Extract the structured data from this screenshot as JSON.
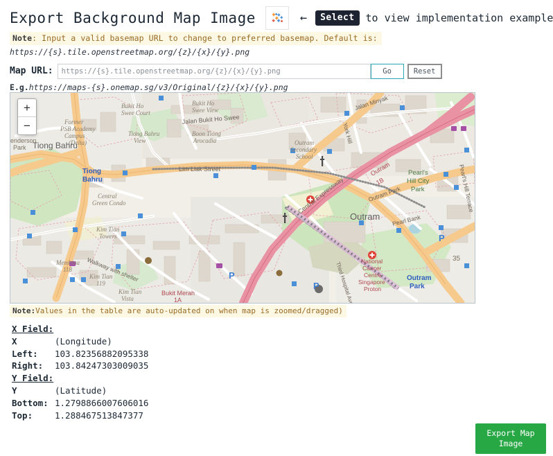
{
  "header": {
    "title": "Export Background Map Image",
    "icon": "scatter-sparkle-icon",
    "arrow": "←",
    "select_badge": "Select",
    "tail_text": "to view implementation example."
  },
  "note_top": {
    "label": "Note",
    "text": ": Input a valid basemap URL to change to preferred basemap. Default is:",
    "default_url": "https://{s}.tile.openstreetmap.org/{z}/{x}/{y}.png",
    "background": "#fcf8e3",
    "text_color": "#9a6b25"
  },
  "url_row": {
    "label": "Map URL:",
    "input_value": "https://{s}.tile.openstreetmap.org/{z}/{x}/{y}.png",
    "input_placeholder": "https://{s}.tile.openstreetmap.org/{z}/{x}/{y}.png",
    "go_label": "Go",
    "reset_label": "Reset",
    "go_border_color": "#2aa8b5",
    "reset_border_color": "#8d8d8d"
  },
  "example": {
    "prefix": "E.g.",
    "url": "https://maps-{s}.onemap.sg/v3/Original/{z}/{x}/{y}.png"
  },
  "map": {
    "zoom_in": "+",
    "zoom_out": "−",
    "attribution": "",
    "labels": [
      "Tiong Bahru",
      "Bukit Ho Swee Court",
      "Bukit Ho Swee View",
      "Former PSB Academy Campus (Delta)",
      "Tiong Bahru View",
      "Jalan Bukit Ho Swee",
      "Boon Tiong Arocadia",
      "Lim Liak Street",
      "Central Green Condo",
      "Henderson Park",
      "Kim Tian Towers",
      "Walkway with shelter",
      "Membina 118",
      "Kim Tian 119",
      "Kim Tian Vista",
      "Bukit Merah 1A",
      "Jalan Minyak",
      "York Hill",
      "Outram Secondary School",
      "Outram 1B",
      "Pearl's Hill City Park",
      "Pearl's Hill Terrace",
      "Central Expressway",
      "Outram",
      "Outram Park",
      "Pearl Bank",
      "National Cancer Centre Singapore Proton",
      "Third Hospital Avenue"
    ]
  },
  "note_bottom": {
    "label": "Note:",
    "text": "Values in the table are auto-updated on when map is zoomed/dragged)"
  },
  "fields": {
    "x_heading": "X Field:",
    "x_key": "X",
    "x_unit": "(Longitude)",
    "left_key": "Left:",
    "left_value": "103.82356882095338",
    "right_key": "Right:",
    "right_value": "103.84247303009035",
    "y_heading": "Y Field:",
    "y_key": "Y",
    "y_unit": "(Latitude)",
    "bottom_key": "Bottom:",
    "bottom_value": "1.2798866007606016",
    "top_key": "Top:",
    "top_value": "1.288467513847377"
  },
  "export": {
    "line1": "Export Map",
    "line2": "Image",
    "color": "#28a745"
  }
}
